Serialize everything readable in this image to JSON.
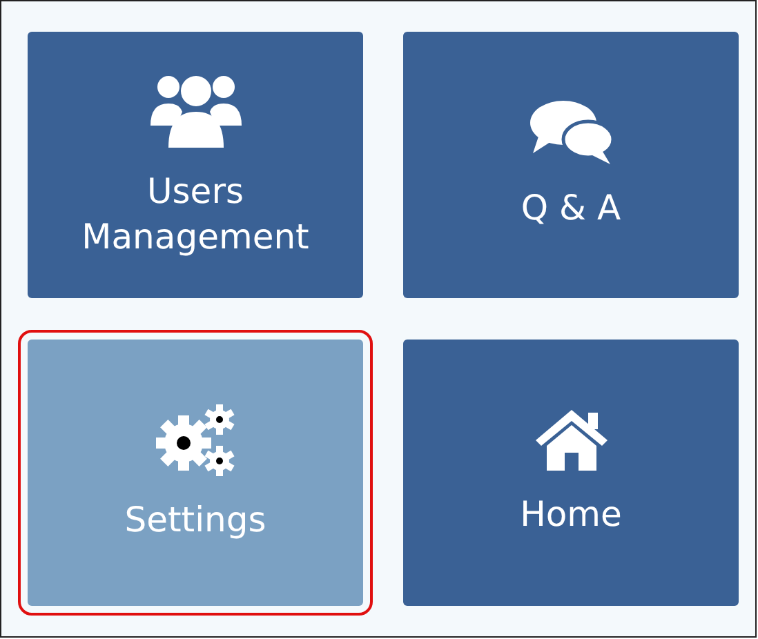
{
  "tiles": [
    {
      "label": "Users Management",
      "kind": "users",
      "selected": false
    },
    {
      "label": "Q & A",
      "kind": "chat",
      "selected": false
    },
    {
      "label": "Settings",
      "kind": "settings",
      "selected": true
    },
    {
      "label": "Home",
      "kind": "home",
      "selected": false
    }
  ]
}
